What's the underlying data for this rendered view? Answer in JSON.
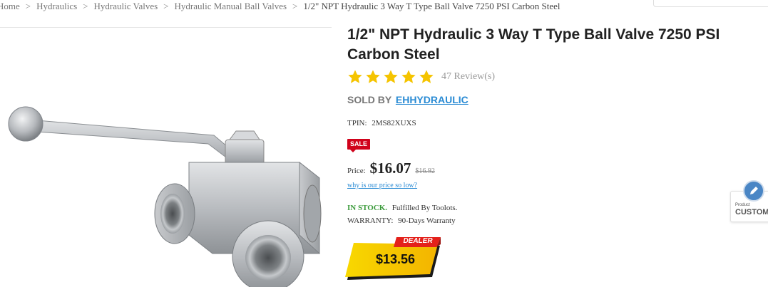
{
  "breadcrumb": {
    "items": [
      "Home",
      "Hydraulics",
      "Hydraulic Valves",
      "Hydraulic Manual Ball Valves"
    ],
    "current": "1/2\" NPT Hydraulic 3 Way T Type Ball Valve 7250 PSI Carbon Steel",
    "separator": ">"
  },
  "product": {
    "title": "1/2\" NPT Hydraulic 3 Way T Type Ball Valve 7250 PSI Carbon Steel",
    "rating_stars": 5,
    "reviews": "47 Review(s)",
    "sold_by_label": "SOLD BY",
    "seller": "EHHYDRAULIC",
    "tpin_label": "TPIN:",
    "tpin": "2MS82XUXS",
    "sale_badge": "SALE",
    "price_label": "Price:",
    "price": "$16.07",
    "old_price": "$16.92",
    "price_link": "why is our price so low?",
    "stock_status": "IN STOCK.",
    "fulfilled": "Fulfilled By Toolots.",
    "warranty_label": "WARRANTY:",
    "warranty": "90-Days Warranty",
    "dealer_label": "DEALER",
    "dealer_price": "$13.56"
  },
  "widget": {
    "small": "Product",
    "label": "CUSTOM"
  },
  "colors": {
    "star": "#f5c400",
    "seller_link": "#2a8bd4",
    "sale": "#d0021b",
    "in_stock": "#3a9a3a",
    "dealer_yellow": "#f7d000"
  }
}
